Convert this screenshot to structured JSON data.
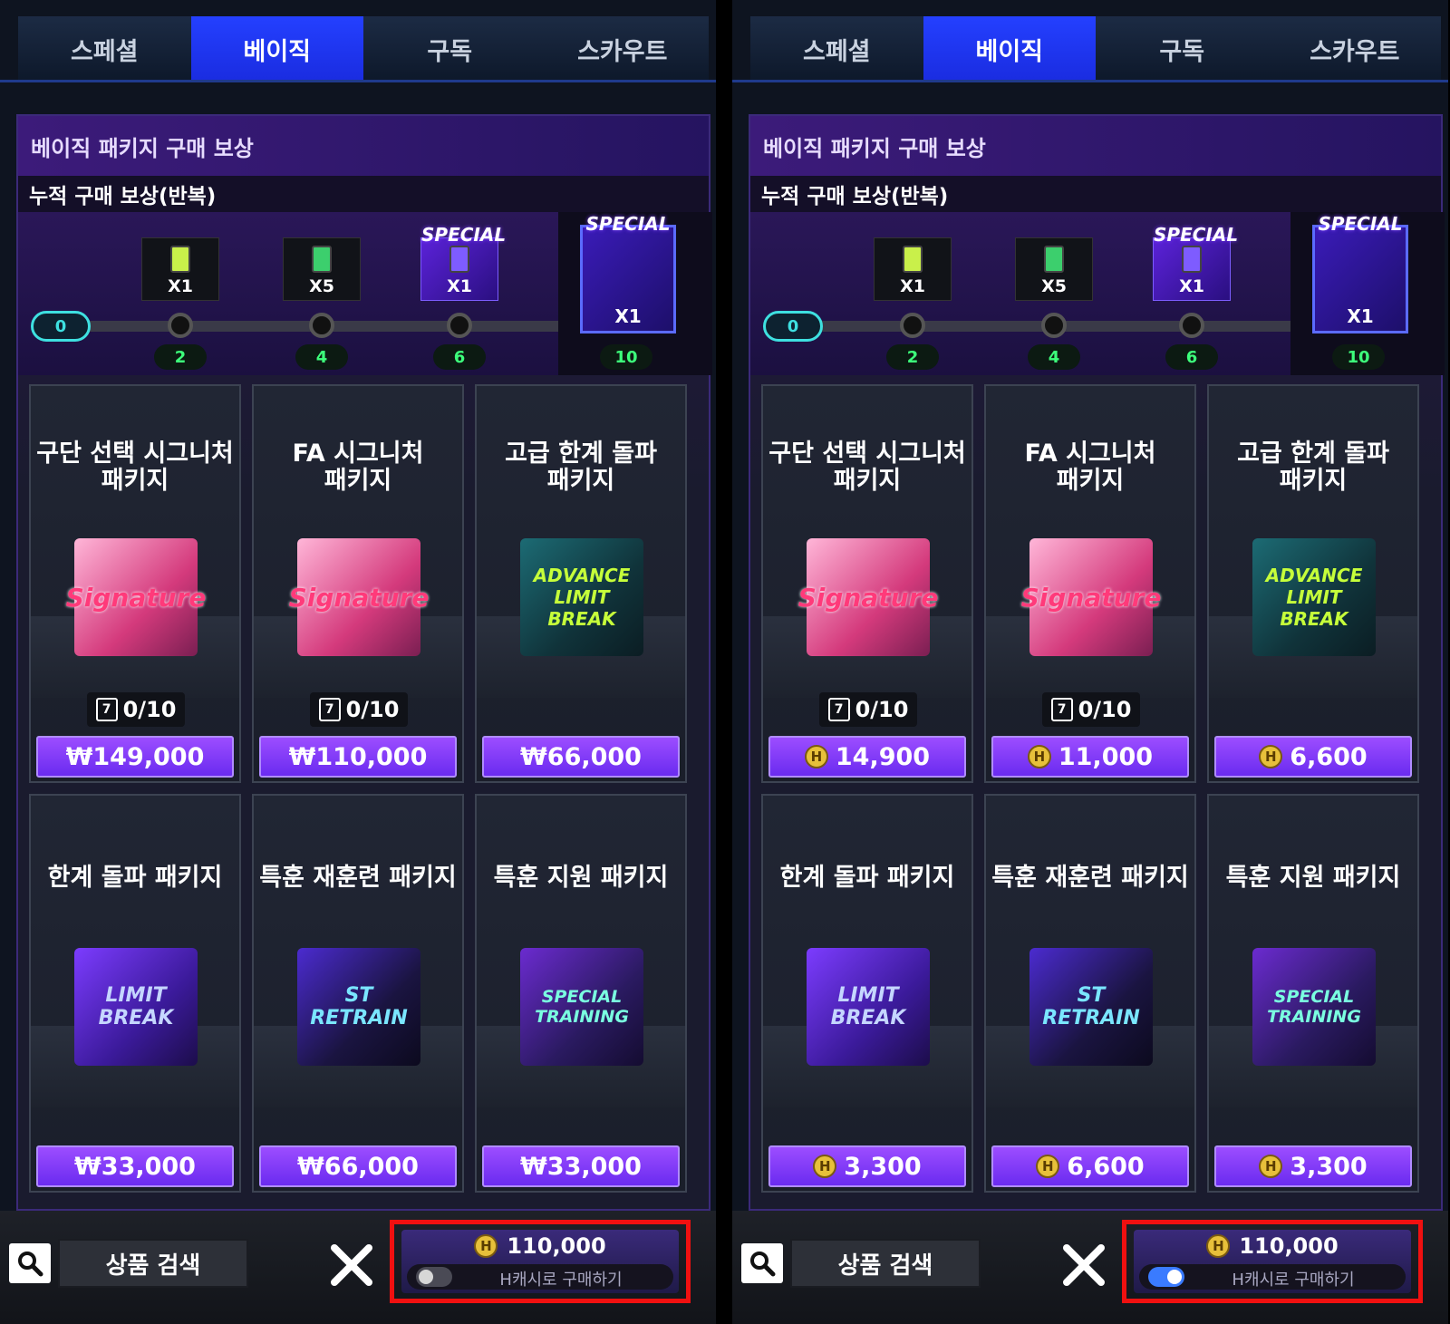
{
  "tabs": [
    "스페셜",
    "베이직",
    "구독",
    "스카우트"
  ],
  "active_tab": 1,
  "panel": {
    "title": "베이직 패키지 구매 보상",
    "subtitle": "누적 구매 보상(반복)",
    "start_step": "0",
    "rewards": [
      {
        "step": "2",
        "qty": "X1",
        "special_label": ""
      },
      {
        "step": "4",
        "qty": "X5",
        "special_label": ""
      },
      {
        "step": "6",
        "qty": "X1",
        "special_label": "SPECIAL"
      },
      {
        "step": "10",
        "qty": "X1",
        "special_label": "SPECIAL"
      }
    ]
  },
  "products": [
    {
      "name_line1": "구단 선택 시그니처",
      "name_line2": "패키지",
      "box_art": "Signature",
      "limit": "0/10"
    },
    {
      "name_line1": "FA 시그니처",
      "name_line2": "패키지",
      "box_art": "Signature",
      "limit": "0/10"
    },
    {
      "name_line1": "고급 한계 돌파",
      "name_line2": "패키지",
      "box_art": "ADVANCE LIMIT BREAK",
      "limit": ""
    },
    {
      "name_line1": "한계 돌파 패키지",
      "name_line2": "",
      "box_art": "LIMIT BREAK",
      "limit": ""
    },
    {
      "name_line1": "특훈 재훈련 패키지",
      "name_line2": "",
      "box_art": "ST RETRAIN",
      "limit": ""
    },
    {
      "name_line1": "특훈 지원 패키지",
      "name_line2": "",
      "box_art": "SPECIAL TRAINING",
      "limit": ""
    }
  ],
  "screens": [
    {
      "prices": [
        "₩149,000",
        "₩110,000",
        "₩66,000",
        "₩33,000",
        "₩66,000",
        "₩33,000"
      ],
      "show_coin": false,
      "total": "110,000",
      "toggle_on": false
    },
    {
      "prices": [
        "14,900",
        "11,000",
        "6,600",
        "3,300",
        "6,600",
        "3,300"
      ],
      "show_coin": true,
      "total": "110,000",
      "toggle_on": true
    }
  ],
  "bottom": {
    "search_label": "상품 검색",
    "toggle_label": "H캐시로 구매하기",
    "coin_symbol": "H"
  },
  "colors": {
    "active_tab": "#2440ff",
    "price_button": "#8a3cff",
    "highlight_border": "#f01010",
    "step_number": "#3dff7b"
  }
}
